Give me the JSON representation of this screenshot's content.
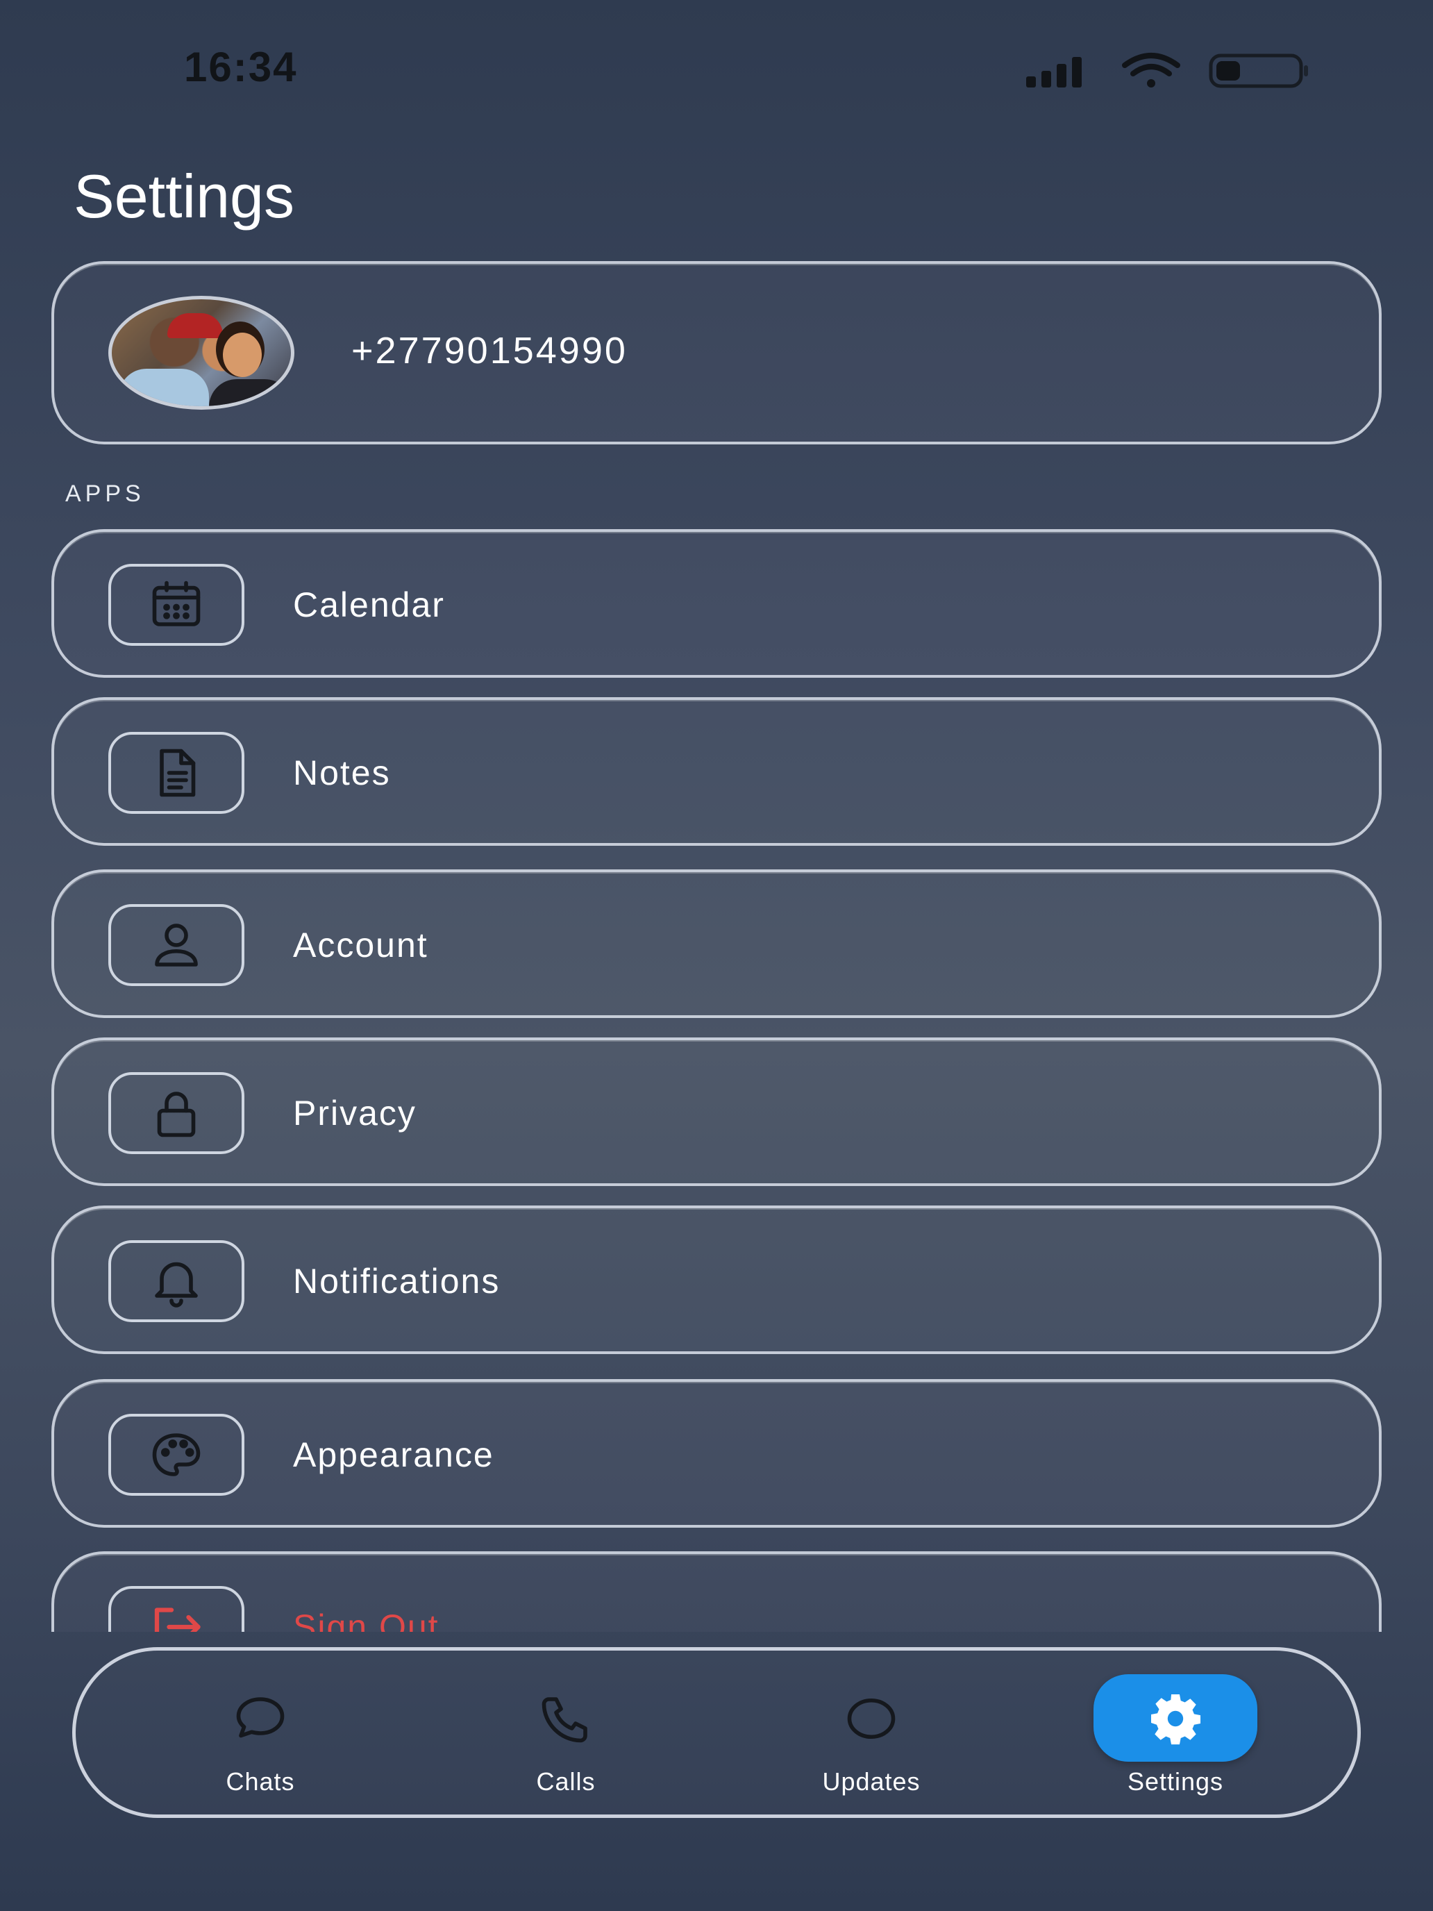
{
  "status_bar": {
    "time": "16:34",
    "icons": [
      "cellular-signal-icon",
      "wifi-icon",
      "battery-icon"
    ],
    "battery_level": 0.3
  },
  "header": {
    "title": "Settings"
  },
  "profile": {
    "phone": "+27790154990"
  },
  "sections": [
    {
      "label": "APPS",
      "items": [
        {
          "label": "Calendar",
          "icon": "calendar-icon"
        },
        {
          "label": "Notes",
          "icon": "document-icon"
        },
        {
          "label": "Account",
          "icon": "user-icon"
        },
        {
          "label": "Privacy",
          "icon": "lock-icon"
        },
        {
          "label": "Notifications",
          "icon": "bell-icon"
        },
        {
          "label": "Appearance",
          "icon": "palette-icon"
        },
        {
          "label": "Sign Out",
          "icon": "sign-out-icon",
          "color": "#e04848"
        }
      ]
    }
  ],
  "tab_bar": {
    "tabs": [
      {
        "label": "Chats",
        "icon": "chat-bubble-icon",
        "active": false
      },
      {
        "label": "Calls",
        "icon": "phone-icon",
        "active": false
      },
      {
        "label": "Updates",
        "icon": "circle-icon",
        "active": false
      },
      {
        "label": "Settings",
        "icon": "gear-icon",
        "active": true
      }
    ]
  },
  "colors": {
    "accent": "#1b8fe8",
    "danger": "#e04848",
    "background": "#3f4a60"
  }
}
